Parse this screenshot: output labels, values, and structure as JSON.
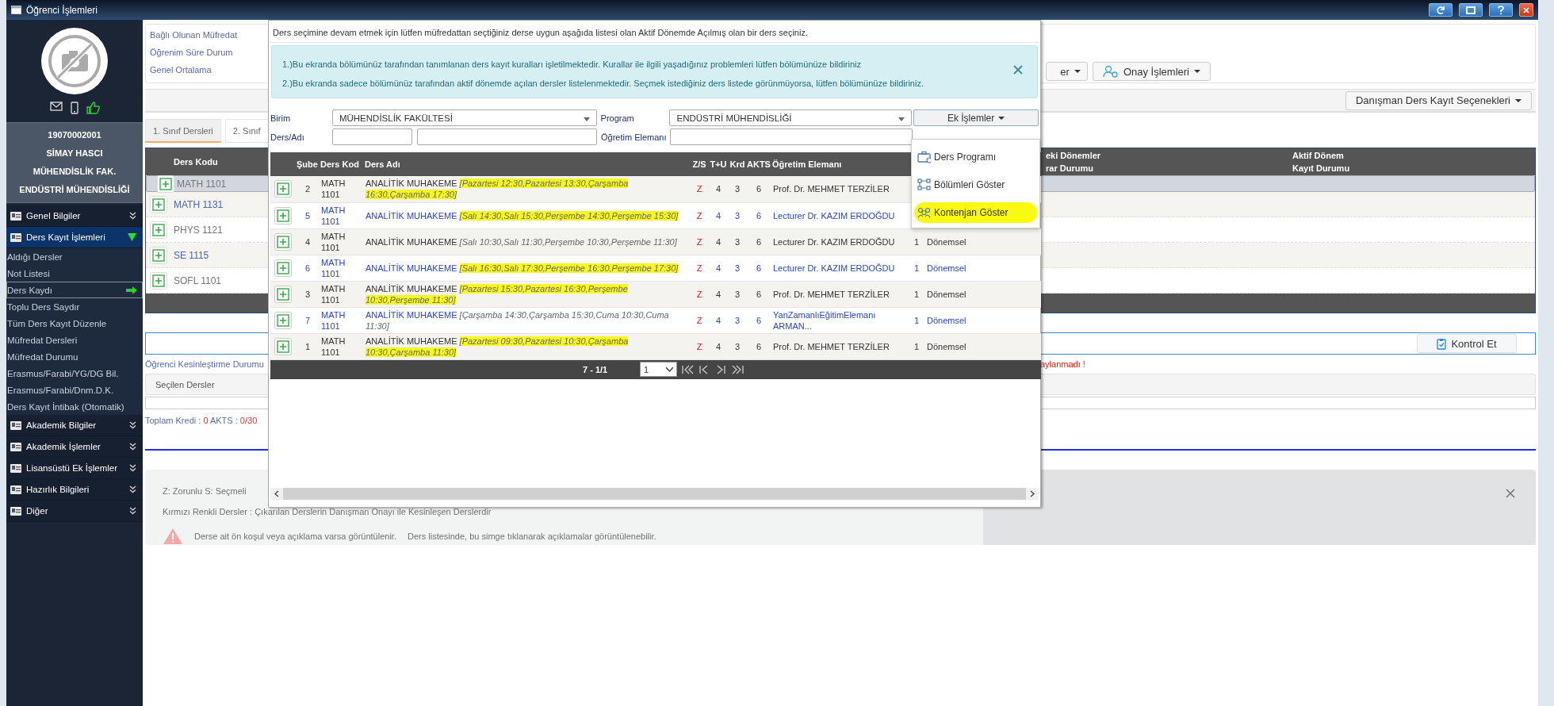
{
  "window": {
    "title": "Öğrenci İşlemleri"
  },
  "profile": {
    "student_no": "19070002001",
    "name": "SİMAY HASCI",
    "faculty": "MÜHENDİSLİK FAK.",
    "department": "ENDÜSTRİ MÜHENDİSLİĞİ"
  },
  "sidebar": {
    "items": [
      {
        "label": "Genel Bilgiler",
        "expanded": false
      },
      {
        "label": "Ders Kayıt İşlemleri",
        "expanded": true,
        "children": [
          {
            "label": "Aldığı Dersler",
            "selected": false
          },
          {
            "label": "Not Listesi",
            "selected": false
          },
          {
            "label": "Ders Kaydı",
            "selected": true
          },
          {
            "label": "Toplu Ders Saydır",
            "selected": false
          },
          {
            "label": "Tüm Ders Kayıt Düzenle",
            "selected": false
          },
          {
            "label": "Müfredat Dersleri",
            "selected": false
          },
          {
            "label": "Müfredat Durumu",
            "selected": false
          },
          {
            "label": "Erasmus/Farabi/YG/DG Bil.",
            "selected": false
          },
          {
            "label": "Erasmus/Farabi/Dnm.D.K.",
            "selected": false
          },
          {
            "label": "Ders Kayıt İntibak (Otomatik)",
            "selected": false
          }
        ]
      },
      {
        "label": "Akademik Bilgiler",
        "expanded": false
      },
      {
        "label": "Akademik İşlemler",
        "expanded": false
      },
      {
        "label": "Lisansüstü Ek İşlemler",
        "expanded": false
      },
      {
        "label": "Hazırlık Bilgileri",
        "expanded": false
      },
      {
        "label": "Diğer",
        "expanded": false
      }
    ]
  },
  "background": {
    "info_labels": [
      "Bağlı Olunan Müfredat",
      "Öğrenim Süre Durum",
      "Genel Ortalama"
    ],
    "action_buttons": [
      "er",
      "Onay İşlemleri"
    ],
    "advisor_button": "Danışman Ders Kayıt Seçenekleri",
    "tabs": [
      {
        "label": "1. Sınıf Dersleri",
        "selected": true
      },
      {
        "label": "2. Sınıf",
        "selected": false
      }
    ],
    "course_table": {
      "columns": [
        "Ders Kodu",
        "eki Dönemler\nrar Durumu",
        "Aktif Dönem\nKayıt Durumu"
      ],
      "rows": [
        {
          "code": "MATH 1101",
          "color": "#777777",
          "selected": true
        },
        {
          "code": "MATH 1131",
          "color": "#4a63c8",
          "selected": false
        },
        {
          "code": "PHYS 1121",
          "color": "#777777",
          "selected": false
        },
        {
          "code": "SE 1115",
          "color": "#4a63c8",
          "selected": false
        },
        {
          "code": "SOFL 1101",
          "color": "#777777",
          "selected": false
        }
      ]
    },
    "check_button": "Kontrol Et",
    "status_label": "Öğrenci Kesinleştirme Durumu",
    "status_value": "aylanmadı !",
    "selected_courses_label": "Seçilen Dersler",
    "totals": {
      "credit_label": "Toplam Kredi :",
      "credit": "0",
      "ects_label": "AKTS :",
      "ects": "0/30"
    },
    "notes": [
      "Z: Zorunlu S: Seçmeli",
      "Kırmızı Renkli Dersler : Çıkarılan Derslerin Danışman Onayı ile Kesinleşen Derslerdir"
    ],
    "warning_notes": [
      "Derse ait ön koşul veya açıklama varsa görüntülenir.",
      "Ders listesinde, bu simge tıklanarak açıklamalar görüntülenebilir."
    ]
  },
  "modal": {
    "intro": "Ders seçimine devam etmek için lütfen müfredattan seçtiğiniz derse uygun aşağıda listesi olan Aktif Dönemde Açılmış olan bir ders seçiniz.",
    "alerts": [
      "1.)Bu ekranda bölümünüz tarafından tanımlanan ders kayıt kuralları işletilmektedir. Kurallar ile ilgili yaşadığınız problemleri lütfen bölümünüze bildiriniz",
      "2.)Bu ekranda sadece bölümünüz tarafından aktif dönemde açılan dersler listelenmektedir. Seçmek istediğiniz ders listede görünmüyorsa, lütfen bölümünüze bildiriniz."
    ],
    "filters": {
      "unit_label": "Birim",
      "unit": "MÜHENDİSLİK FAKÜLTESİ",
      "program_label": "Program",
      "program": "ENDÜSTRİ MÜHENDİSLİĞİ",
      "course_label": "Ders/Adı",
      "instructor_label": "Öğretim Elemanı"
    },
    "extra_button": "Ek İşlemler",
    "extra_menu": [
      {
        "label": "Ders Programı",
        "highlighted": false
      },
      {
        "label": "Bölümleri Göster",
        "highlighted": false
      },
      {
        "label": "Kontenjan Göster",
        "highlighted": true
      }
    ],
    "table": {
      "columns": [
        "Şube",
        "Ders Kod",
        "Ders Adı",
        "Z/S",
        "T+U",
        "Krd",
        "AKTS",
        "Öğretim Elemanı"
      ],
      "rows": [
        {
          "section": "2",
          "code": "MATH 1101",
          "name": "ANALİTİK MUHAKEME",
          "schedule": "[Pazartesi 12:30,Pazartesi 13:30,Çarşamba 16:30,Çarşamba 17:30]",
          "schedule_highlighted": true,
          "zs": "Z",
          "tu": "4",
          "krd": "3",
          "akts": "6",
          "instructor": "Prof. Dr. MEHMET TERZİLER",
          "color": "#333333"
        },
        {
          "section": "5",
          "code": "MATH 1101",
          "name": "ANALİTİK MUHAKEME",
          "schedule": "[Salı 14:30,Salı 15:30,Perşembe 14:30,Perşembe 15:30]",
          "schedule_highlighted": true,
          "zs": "Z",
          "tu": "4",
          "krd": "3",
          "akts": "6",
          "instructor": "Lecturer Dr. KAZIM ERDOĞDU",
          "color": "#2b46b8"
        },
        {
          "section": "4",
          "code": "MATH 1101",
          "name": "ANALİTİK MUHAKEME",
          "schedule": "[Salı 10:30,Salı 11:30,Perşembe 10:30,Perşembe 11:30]",
          "schedule_highlighted": false,
          "zs": "Z",
          "tu": "4",
          "krd": "3",
          "akts": "6",
          "instructor": "Lecturer Dr. KAZIM ERDOĞDU",
          "column_10": "1",
          "column_11": "Dönemsel",
          "color": "#333333"
        },
        {
          "section": "6",
          "code": "MATH 1101",
          "name": "ANALİTİK MUHAKEME",
          "schedule": "[Salı 16:30,Salı 17:30,Perşembe 16:30,Perşembe 17:30]",
          "schedule_highlighted": true,
          "zs": "Z",
          "tu": "4",
          "krd": "3",
          "akts": "6",
          "instructor": "Lecturer Dr. KAZIM ERDOĞDU",
          "column_10": "1",
          "column_11": "Dönemsel",
          "color": "#2b46b8"
        },
        {
          "section": "3",
          "code": "MATH 1101",
          "name": "ANALİTİK MUHAKEME",
          "schedule": "[Pazartesi 15:30,Pazartesi 16:30,Perşembe 10:30,Perşembe 11:30]",
          "schedule_highlighted": true,
          "zs": "Z",
          "tu": "4",
          "krd": "3",
          "akts": "6",
          "instructor": "Prof. Dr. MEHMET TERZİLER",
          "column_10": "1",
          "column_11": "Dönemsel",
          "color": "#333333"
        },
        {
          "section": "7",
          "code": "MATH 1101",
          "name": "ANALİTİK MUHAKEME",
          "schedule": "[Çarşamba 14:30,Çarşamba 15:30,Cuma 10:30,Cuma 11:30]",
          "schedule_highlighted": false,
          "zs": "Z",
          "tu": "4",
          "krd": "3",
          "akts": "6",
          "instructor": "YanZamanlıEğitimElemanı ARMAN...",
          "column_10": "1",
          "column_11": "Dönemsel",
          "color": "#2b46b8"
        },
        {
          "section": "1",
          "code": "MATH 1101",
          "name": "ANALİTİK MUHAKEME",
          "schedule": "[Pazartesi 09:30,Pazartesi 10:30,Çarşamba 10:30,Çarşamba 11:30]",
          "schedule_highlighted": true,
          "zs": "Z",
          "tu": "4",
          "krd": "3",
          "akts": "6",
          "instructor": "Prof. Dr. MEHMET TERZİLER",
          "column_10": "1",
          "column_11": "Dönemsel",
          "color": "#333333"
        }
      ]
    },
    "pager": {
      "summary": "7 - 1/1",
      "page": "1"
    }
  }
}
